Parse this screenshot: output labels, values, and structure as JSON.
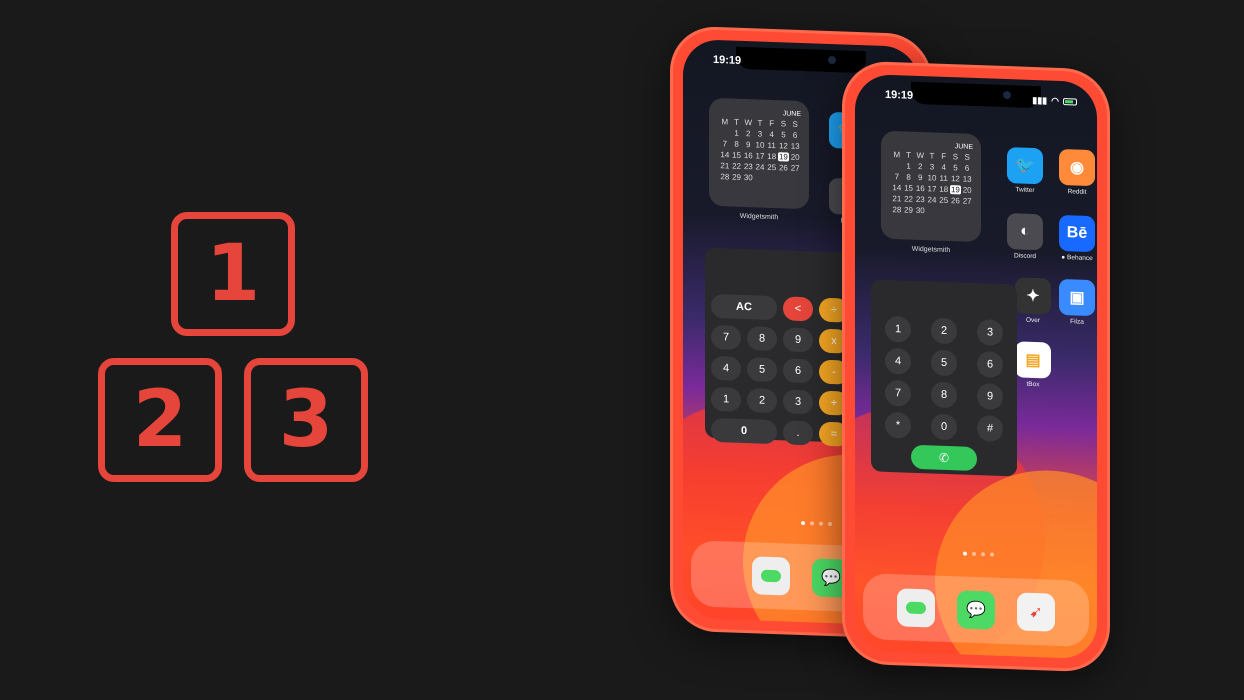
{
  "logo": {
    "blocks": [
      "1",
      "2",
      "3"
    ],
    "color": "#e5453a"
  },
  "phone_back": {
    "time": "19:19",
    "calendar": {
      "month": "JUNE",
      "weekdays": [
        "M",
        "T",
        "W",
        "T",
        "F",
        "S",
        "S"
      ],
      "days": [
        "",
        "1",
        "2",
        "3",
        "4",
        "5",
        "6",
        "7",
        "8",
        "9",
        "10",
        "11",
        "12",
        "13",
        "14",
        "15",
        "16",
        "17",
        "18",
        "19",
        "20",
        "21",
        "22",
        "23",
        "24",
        "25",
        "26",
        "27",
        "28",
        "29",
        "30",
        "",
        "",
        "",
        ""
      ],
      "today": "19",
      "label": "Widgetsmith"
    },
    "apps": [
      {
        "label": "Twi"
      },
      {
        "label": "Disc"
      }
    ],
    "calculator": {
      "rows": [
        [
          "AC",
          "<",
          "÷"
        ],
        [
          "7",
          "8",
          "9",
          "x"
        ],
        [
          "4",
          "5",
          "6",
          "-"
        ],
        [
          "1",
          "2",
          "3",
          "+"
        ],
        [
          "0",
          ".",
          "="
        ]
      ]
    }
  },
  "phone_front": {
    "time": "19:19",
    "calendar": {
      "month": "JUNE",
      "weekdays": [
        "M",
        "T",
        "W",
        "T",
        "F",
        "S",
        "S"
      ],
      "days": [
        "",
        "1",
        "2",
        "3",
        "4",
        "5",
        "6",
        "7",
        "8",
        "9",
        "10",
        "11",
        "12",
        "13",
        "14",
        "15",
        "16",
        "17",
        "18",
        "19",
        "20",
        "21",
        "22",
        "23",
        "24",
        "25",
        "26",
        "27",
        "28",
        "29",
        "30",
        "",
        "",
        "",
        ""
      ],
      "today": "19",
      "label": "Widgetsmith"
    },
    "apps": [
      {
        "label": "Twitter",
        "glyph": "🐦",
        "color": "#1da1f2"
      },
      {
        "label": "Reddit",
        "glyph": "◉",
        "color": "#ff8a3a"
      },
      {
        "label": "Discord",
        "glyph": "◐",
        "color": "#4a4a50"
      },
      {
        "label": "● Behance",
        "glyph": "Bē",
        "color": "#1769ff"
      },
      {
        "label": "Over",
        "glyph": "✦",
        "color": "#333"
      },
      {
        "label": "Filza",
        "glyph": "▣",
        "color": "#3a8bff"
      },
      {
        "label": "tBox",
        "glyph": "▤",
        "color": "#fff"
      }
    ],
    "dialer": {
      "rows": [
        [
          "1",
          "2",
          "3"
        ],
        [
          "4",
          "5",
          "6"
        ],
        [
          "7",
          "8",
          "9"
        ],
        [
          "*",
          "0",
          "#"
        ]
      ],
      "call_glyph": "✆"
    }
  }
}
